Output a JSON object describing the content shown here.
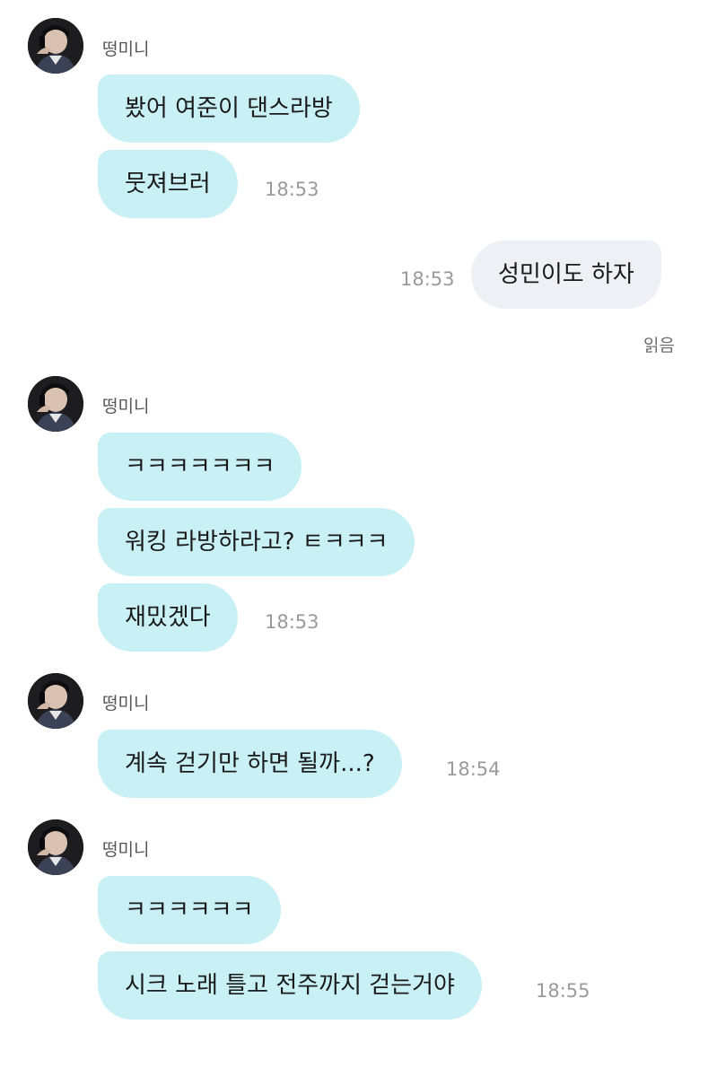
{
  "chat": {
    "sender_name": "떵미니",
    "read_label": "읽음",
    "groups": [
      {
        "messages": [
          {
            "text": "봤어 여준이 댄스라방",
            "time": ""
          },
          {
            "text": "뭇져브러",
            "time": "18:53"
          }
        ]
      },
      {
        "outgoing": {
          "text": "성민이도 하자",
          "time": "18:53"
        }
      },
      {
        "messages": [
          {
            "text": "ㅋㅋㅋㅋㅋㅋㅋ",
            "time": ""
          },
          {
            "text": "워킹 라방하라고? ㅌㅋㅋㅋ",
            "time": ""
          },
          {
            "text": "재밌겠다",
            "time": "18:53"
          }
        ]
      },
      {
        "messages": [
          {
            "text": "계속 걷기만 하면 될까...?",
            "time": "18:54"
          }
        ]
      },
      {
        "messages": [
          {
            "text": "ㅋㅋㅋㅋㅋㅋ",
            "time": ""
          },
          {
            "text": "시크 노래 틀고 전주까지 걷는거야",
            "time": "18:55"
          }
        ]
      }
    ]
  },
  "colors": {
    "incoming_bubble": "#c9f1f5",
    "outgoing_bubble": "#eff0f5",
    "timestamp": "#9a9a9a"
  },
  "icons": {
    "avatar": "profile-photo-person-with-headphones"
  }
}
